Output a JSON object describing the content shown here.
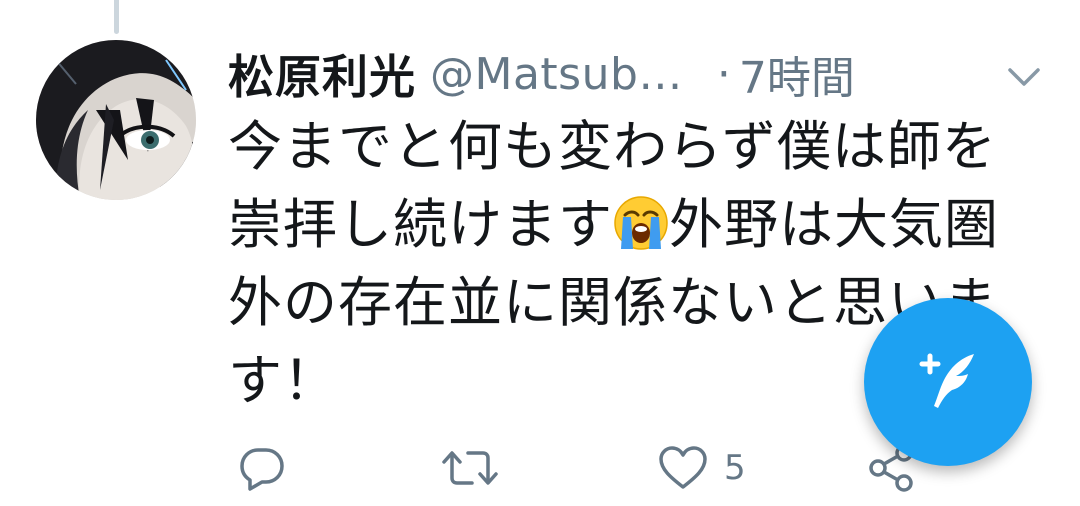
{
  "tweet": {
    "display_name": "松原利光",
    "handle": "@Matsub…",
    "separator": "·",
    "timestamp": "7時間",
    "text_before_emoji": "今までと何も変わらず僕は師を崇拝し続けます",
    "emoji": "loudly-crying-face",
    "text_after_emoji": "外野は大気圏外の存在並に関係ないと思います！",
    "like_count": "5"
  },
  "icons": {
    "caret": "chevron-down-icon",
    "reply": "reply-icon",
    "retweet": "retweet-icon",
    "like": "heart-icon",
    "share": "share-icon",
    "compose": "compose-tweet-icon"
  },
  "colors": {
    "brand": "#1da1f2",
    "secondary_text": "#657786",
    "primary_text": "#14171a",
    "thread_line": "#ccd6dd"
  }
}
